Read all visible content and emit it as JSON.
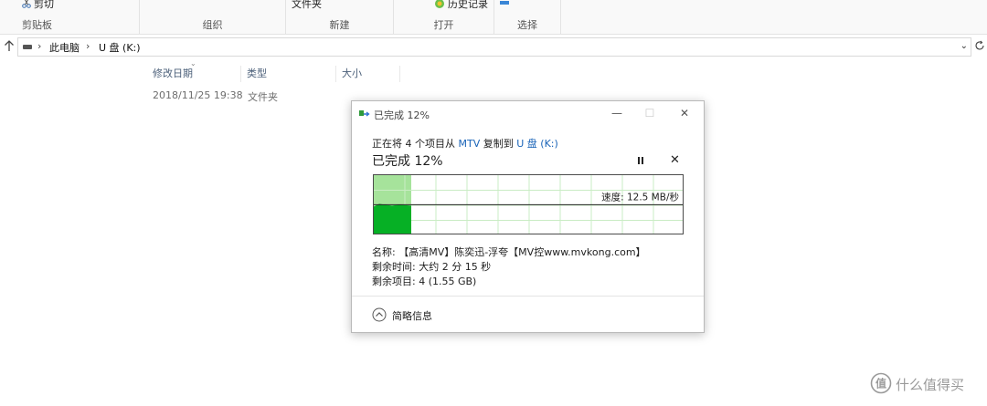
{
  "ribbon": {
    "cut": "剪切",
    "groups": [
      "剪贴板",
      "组织",
      "新建",
      "打开",
      "选择"
    ],
    "new_folder": "文件夹",
    "history": "历史记录"
  },
  "address": {
    "crumbs": [
      "此电脑",
      "U 盘 (K:)"
    ]
  },
  "file_list": {
    "columns": [
      "修改日期",
      "类型",
      "大小"
    ],
    "rows": [
      {
        "date": "2018/11/25 19:38",
        "type": "文件夹",
        "size": ""
      }
    ]
  },
  "dialog": {
    "title": "已完成 12%",
    "line_prefix": "正在将 4 个项目从 ",
    "source": "MTV",
    "line_mid": " 复制到 ",
    "dest": "U 盘 (K:)",
    "big_status": "已完成 12%",
    "progress": 0.12,
    "speed_text": "速度: 12.5 MB/秒",
    "name_line": "名称: 【高清MV】陈奕迅-浮夸【MV控www.mvkong.com】",
    "time_line": "剩余时间: 大约 2 分 15 秒",
    "items_line": "剩余项目: 4 (1.55 GB)",
    "details_label": "简略信息",
    "progress_color": "#06b025",
    "progress_light_color": "#a6e39b"
  },
  "watermark": {
    "text": "什么值得买"
  }
}
